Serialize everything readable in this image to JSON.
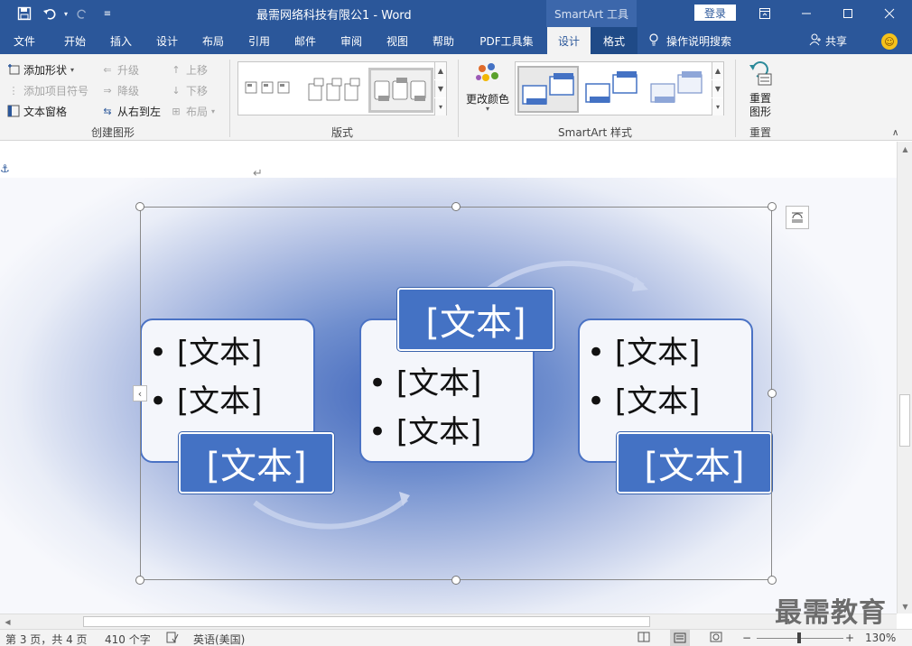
{
  "window": {
    "title": "最需网络科技有限公1 - Word",
    "context_tab_header": "SmartArt 工具",
    "login_label": "登录"
  },
  "tabs": [
    {
      "label": "文件"
    },
    {
      "label": "开始"
    },
    {
      "label": "插入"
    },
    {
      "label": "设计"
    },
    {
      "label": "布局"
    },
    {
      "label": "引用"
    },
    {
      "label": "邮件"
    },
    {
      "label": "审阅"
    },
    {
      "label": "视图"
    },
    {
      "label": "帮助"
    },
    {
      "label": "PDF工具集"
    },
    {
      "label": "设计"
    },
    {
      "label": "格式"
    }
  ],
  "help_search": "操作说明搜索",
  "share_label": "共享",
  "ribbon": {
    "create_graphic": {
      "label": "创建图形",
      "add_shape": "添加形状",
      "add_bullet": "添加项目符号",
      "text_pane": "文本窗格",
      "promote": "升级",
      "demote": "降级",
      "right_to_left": "从右到左",
      "move_up": "上移",
      "move_down": "下移",
      "layout": "布局"
    },
    "layouts": {
      "label": "版式"
    },
    "styles": {
      "label": "SmartArt 样式",
      "change_colors": "更改颜色"
    },
    "reset": {
      "label": "重置",
      "reset_graphic": "重置\n图形"
    }
  },
  "smartart": {
    "placeholder": "[文本]",
    "bullet_char": "•",
    "accent_color": "#4472c4"
  },
  "status": {
    "page": "第 3 页，共 4 页",
    "words": "410 个字",
    "language": "英语(美国)",
    "zoom": "130%",
    "zoom_minus": "−",
    "zoom_plus": "+"
  },
  "watermark": "最需教育"
}
